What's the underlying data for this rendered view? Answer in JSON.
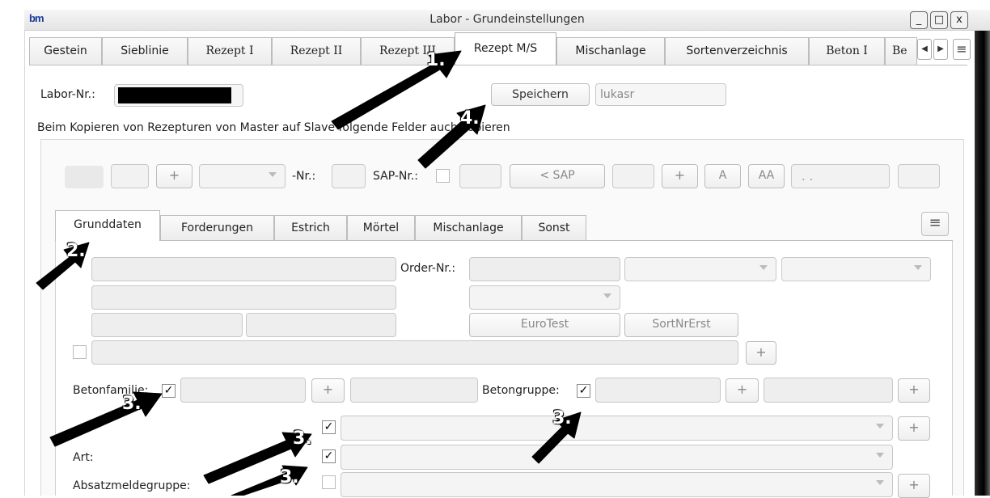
{
  "window": {
    "title": "Labor - Grundeinstellungen",
    "icon_text": "bm",
    "controls": [
      "_",
      "□",
      "x"
    ]
  },
  "tabs": [
    {
      "label": "Gestein"
    },
    {
      "label": "Sieblinie"
    },
    {
      "label": "Rezept I"
    },
    {
      "label": "Rezept II"
    },
    {
      "label": "Rezept III"
    },
    {
      "label": "Rezept M/S",
      "active": true
    },
    {
      "label": "Mischanlage"
    },
    {
      "label": "Sortenverzeichnis"
    },
    {
      "label": "Beton I"
    },
    {
      "label": "Be"
    }
  ],
  "tab_nav": {
    "prev": "◀",
    "next": "▶",
    "menu": "≡"
  },
  "form": {
    "labor_nr_label": "Labor-Nr.:",
    "labor_nr_value": "",
    "save_button": "Speichern",
    "user_value": "lukasr",
    "copy_info": "Beim Kopieren von Rezepturen von Master auf Slave folgende Felder auch kopieren"
  },
  "copy_row": {
    "plus": "+",
    "nr_label": "-Nr.:",
    "sap_label": "SAP-Nr.:",
    "sap_button": "< SAP",
    "a_button": "A",
    "aa_button": "AA",
    "dots_value": ". ."
  },
  "inner_tabs": [
    {
      "label": "Grunddaten",
      "active": true
    },
    {
      "label": "Forderungen"
    },
    {
      "label": "Estrich"
    },
    {
      "label": "Mörtel"
    },
    {
      "label": "Mischanlage"
    },
    {
      "label": "Sonst"
    }
  ],
  "grunddaten": {
    "order_nr_label": "Order-Nr.:",
    "eurotest_button": "EuroTest",
    "sortnrerst_button": "SortNrErst",
    "betonfamilie_label": "Betonfamilie:",
    "betongruppe_label": "Betongruppe:",
    "art_label": "Art:",
    "absatzmeldegruppe_label": "Absatzmeldegruppe:",
    "check_mark": "✓",
    "plus": "+"
  },
  "annotations": [
    "1.",
    "2.",
    "3.",
    "3.",
    "3.",
    "3.",
    "3.",
    "4."
  ]
}
